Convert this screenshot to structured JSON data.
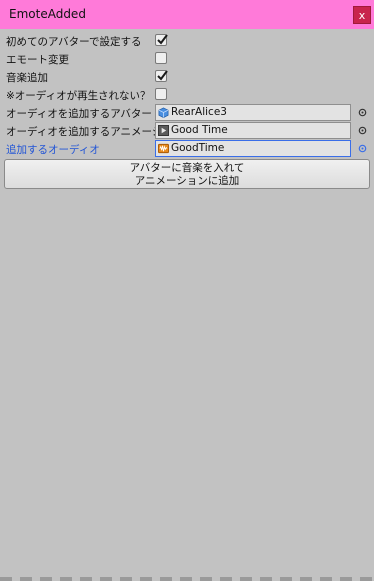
{
  "window": {
    "title": "EmoteAdded",
    "close_label": "x"
  },
  "settings": {
    "first_avatar_label": "初めてのアバターで設定する",
    "first_avatar_checked": true,
    "emote_change_label": "エモート変更",
    "emote_change_checked": false,
    "music_add_label": "音楽追加",
    "music_add_checked": true,
    "audio_not_playing_label": "※オーディオが再生されない？",
    "audio_not_playing_checked": false
  },
  "fields": {
    "avatar_label": "オーディオを追加するアバター",
    "avatar_value": "RearAlice3",
    "animation_label": "オーディオを追加するアニメーション",
    "animation_value": "Good Time",
    "audio_label": "追加するオーディオ",
    "audio_value": "GoodTime"
  },
  "action_button": {
    "line1": "アバターに音楽を入れて",
    "line2": "アニメーションに追加"
  },
  "colors": {
    "titlebar": "#ff7ad9",
    "close": "#c8244c",
    "accent_blue": "#2255d6",
    "background": "#c2c2c2"
  }
}
